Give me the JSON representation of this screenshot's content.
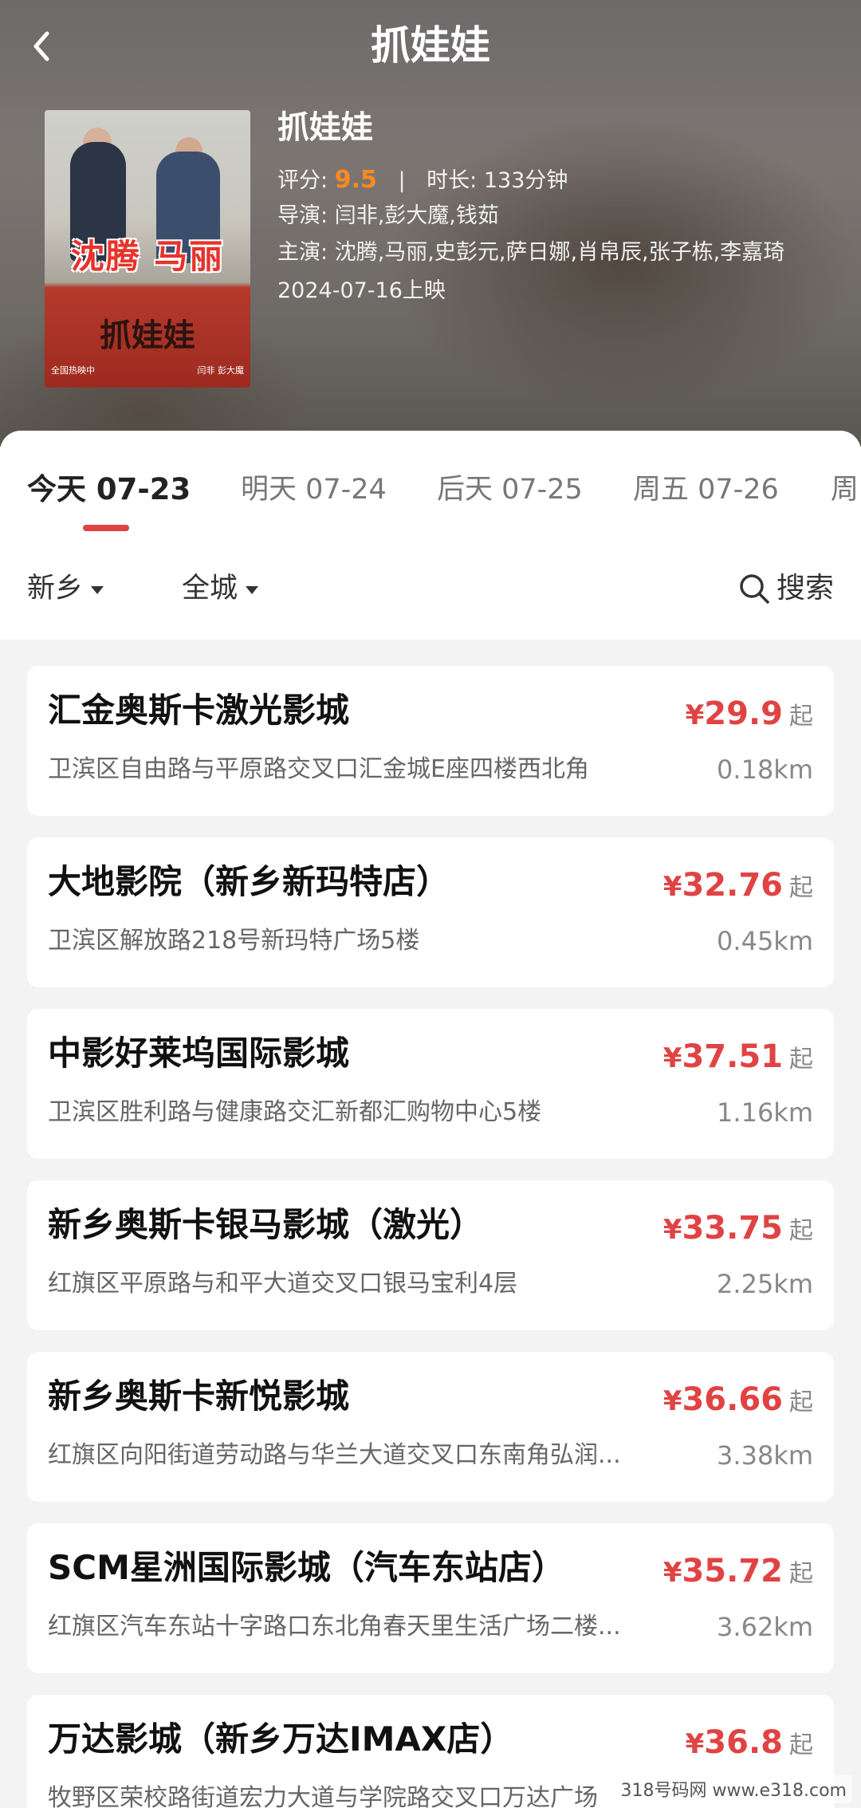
{
  "header": {
    "nav_title": "抓娃娃",
    "back_icon": "chevron-left-icon"
  },
  "movie": {
    "title": "抓娃娃",
    "score_label": "评分:",
    "score": "9.5",
    "duration_label": "时长:",
    "duration": "133分钟",
    "director_label": "导演:",
    "director": "闫非,彭大魔,钱茹",
    "cast_label": "主演:",
    "cast": "沈腾,马丽,史彭元,萨日娜,肖帛辰,张子栋,李嘉琦",
    "release": "2024-07-16上映",
    "poster": {
      "names": "沈腾 马丽",
      "title": "抓娃娃",
      "left_foot": "全国热映中",
      "right_foot": "闫非 彭大魔"
    }
  },
  "date_tabs": [
    {
      "label": "今天 07-23",
      "active": true
    },
    {
      "label": "明天 07-24",
      "active": false
    },
    {
      "label": "后天 07-25",
      "active": false
    },
    {
      "label": "周五 07-26",
      "active": false
    },
    {
      "label": "周",
      "active": false
    }
  ],
  "filters": {
    "city": "新乡",
    "area": "全城",
    "search": "搜索"
  },
  "colors": {
    "accent": "#e04343",
    "score": "#ff8a1e"
  },
  "cinemas": [
    {
      "name": "汇金奥斯卡激光影城",
      "address": "卫滨区自由路与平原路交叉口汇金城E座四楼西北角",
      "yen": "¥",
      "price": "29.9",
      "suffix": "起",
      "distance": "0.18km"
    },
    {
      "name": "大地影院（新乡新玛特店）",
      "address": "卫滨区解放路218号新玛特广场5楼",
      "yen": "¥",
      "price": "32.76",
      "suffix": "起",
      "distance": "0.45km"
    },
    {
      "name": "中影好莱坞国际影城",
      "address": "卫滨区胜利路与健康路交汇新都汇购物中心5楼",
      "yen": "¥",
      "price": "37.51",
      "suffix": "起",
      "distance": "1.16km"
    },
    {
      "name": "新乡奥斯卡银马影城（激光）",
      "address": "红旗区平原路与和平大道交叉口银马宝利4层",
      "yen": "¥",
      "price": "33.75",
      "suffix": "起",
      "distance": "2.25km"
    },
    {
      "name": "新乡奥斯卡新悦影城",
      "address": "红旗区向阳街道劳动路与华兰大道交叉口东南角弘润...",
      "yen": "¥",
      "price": "36.66",
      "suffix": "起",
      "distance": "3.38km"
    },
    {
      "name": "SCM星洲国际影城（汽车东站店）",
      "address": "红旗区汽车东站十字路口东北角春天里生活广场二楼...",
      "yen": "¥",
      "price": "35.72",
      "suffix": "起",
      "distance": "3.62km"
    },
    {
      "name": "万达影城（新乡万达IMAX店）",
      "address": "牧野区荣校路街道宏力大道与学院路交叉口万达广场",
      "yen": "¥",
      "price": "36.8",
      "suffix": "起",
      "distance": ""
    }
  ],
  "watermark": "318号码网  www.e318.com"
}
